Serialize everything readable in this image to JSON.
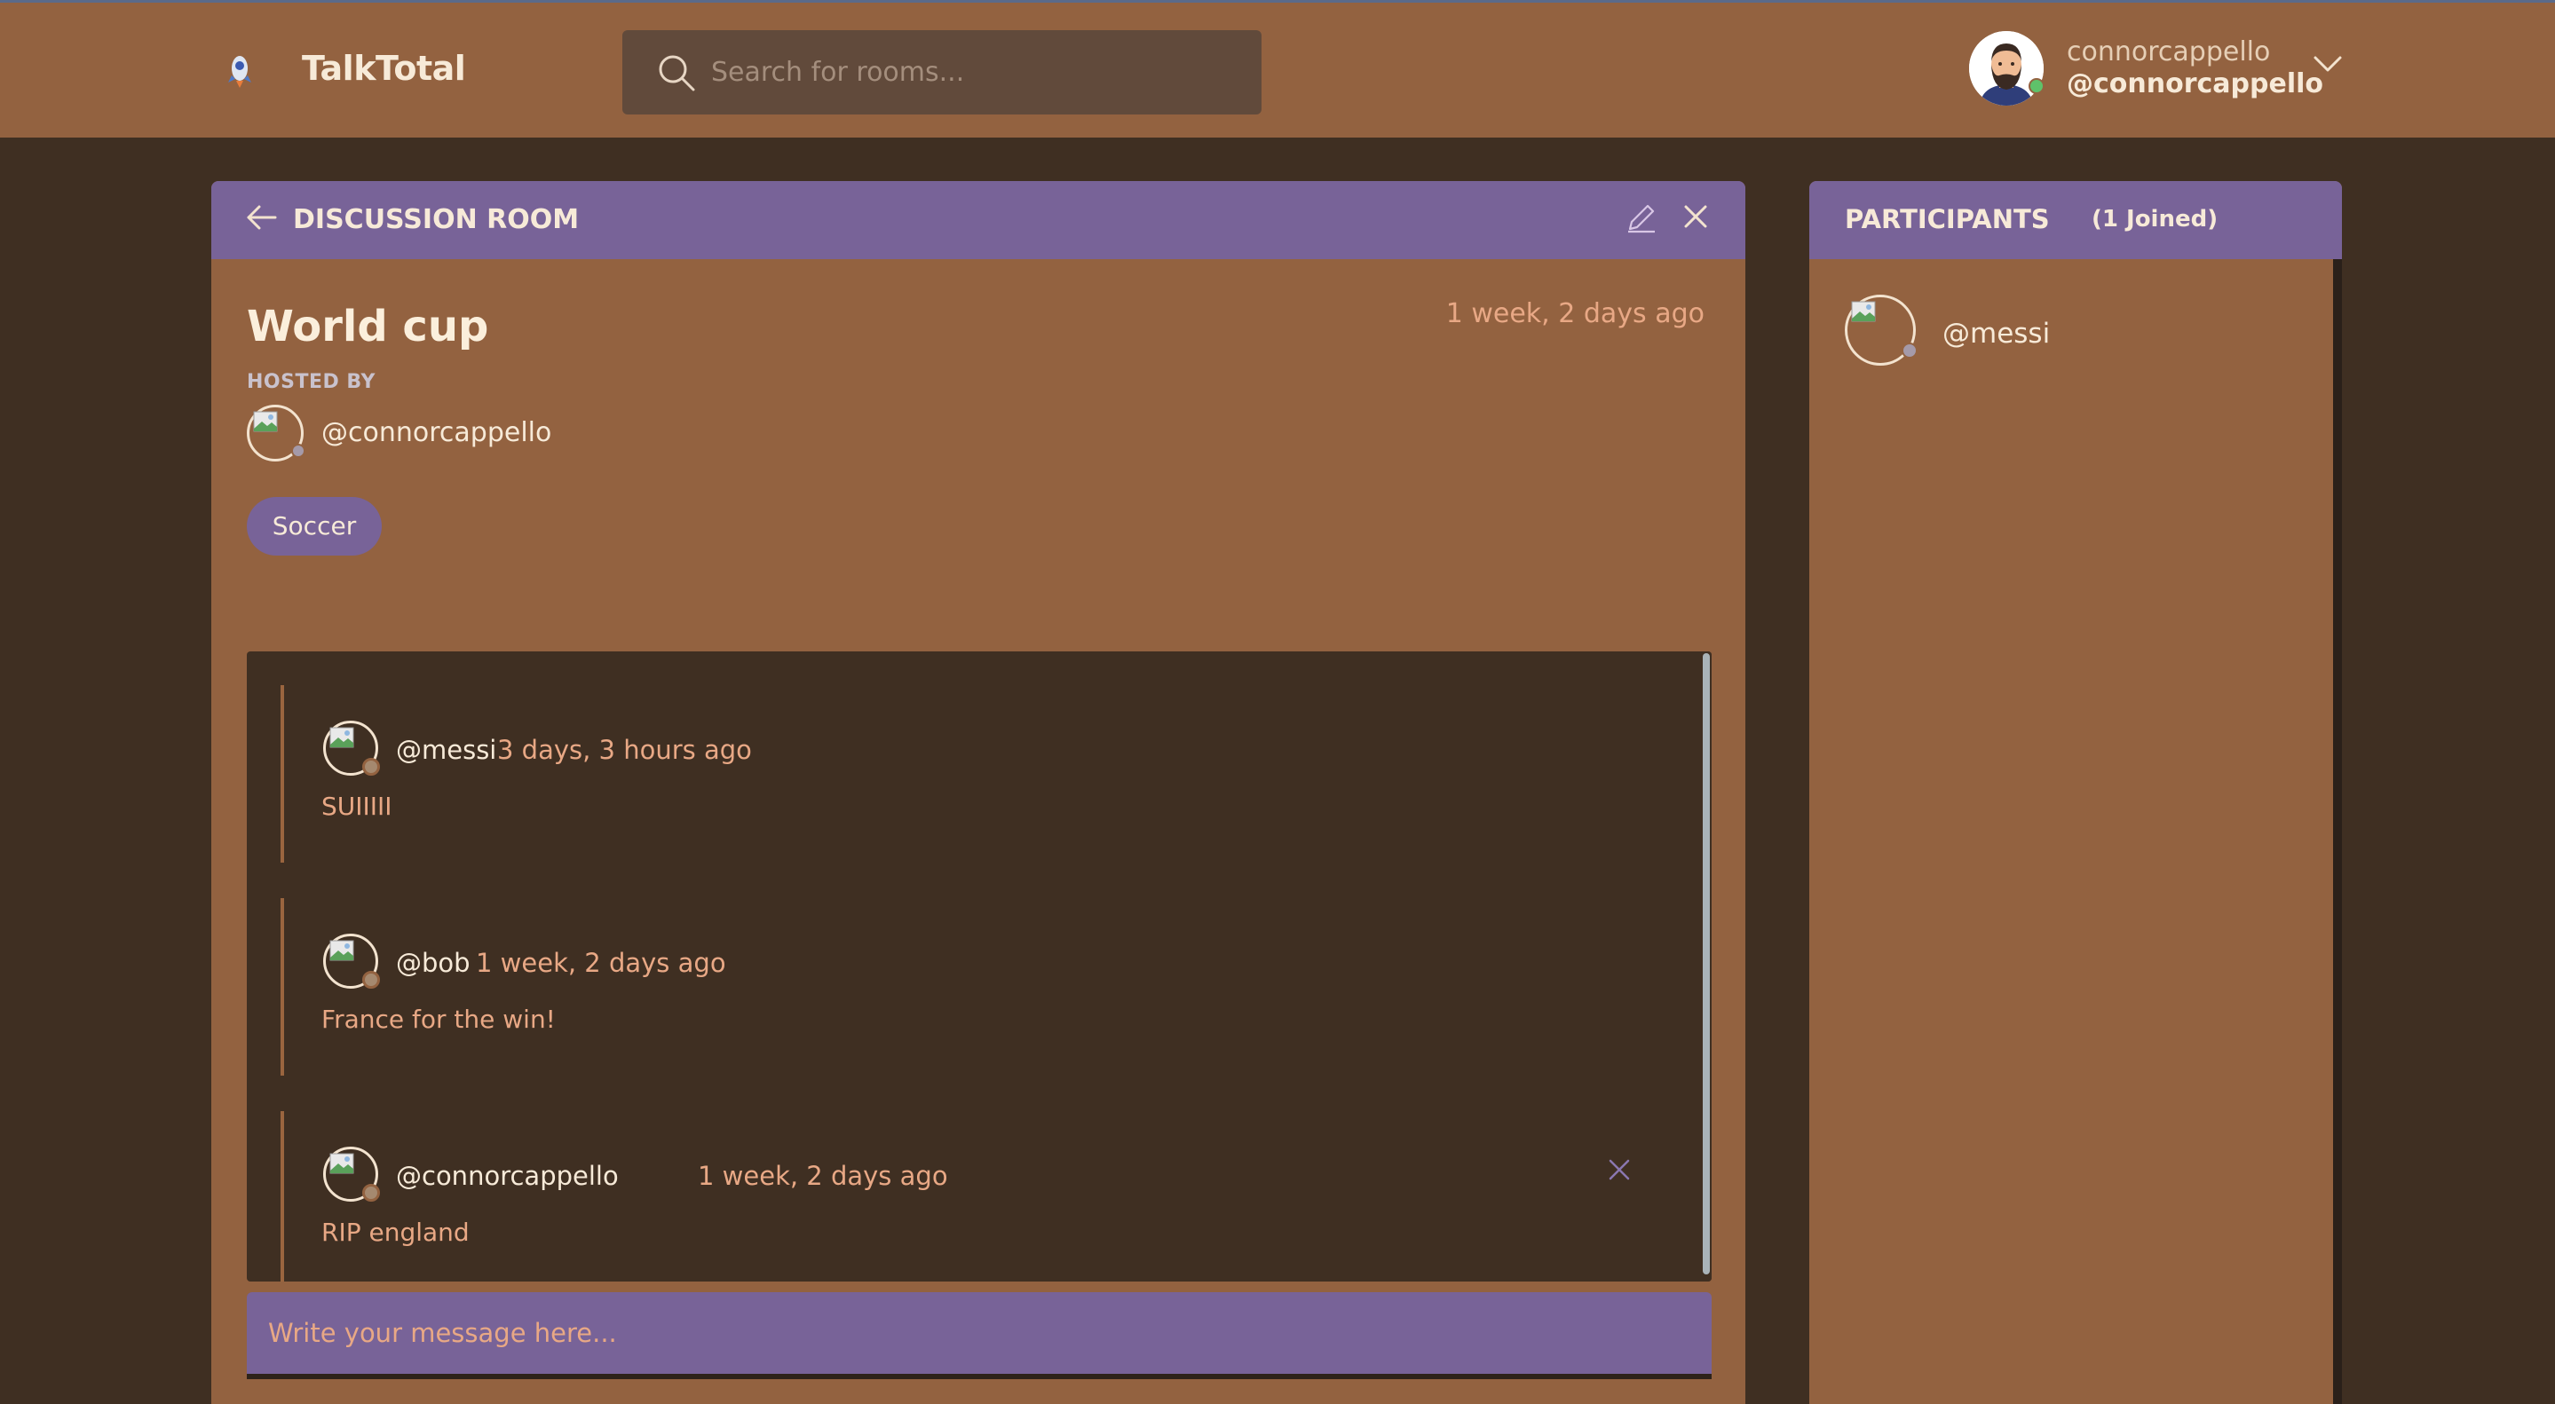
{
  "app": {
    "brand": "TalkTotal",
    "search_placeholder": "Search for rooms..."
  },
  "user": {
    "name": "connorcappello",
    "handle": "@connorcappello",
    "status": "online"
  },
  "room": {
    "header_label": "DISCUSSION ROOM",
    "title": "World cup",
    "created": "1 week, 2 days ago",
    "hosted_by_label": "HOSTED BY",
    "host": "@connorcappello",
    "topic": "Soccer",
    "composer_placeholder": "Write your message here..."
  },
  "messages": [
    {
      "user": "@messi",
      "time": "3 days, 3 hours ago",
      "body": "SUIIIII",
      "deletable": false
    },
    {
      "user": "@bob",
      "time": "1 week, 2 days ago",
      "body": "France for the win!",
      "deletable": false
    },
    {
      "user": "@connorcappello",
      "time": "1 week, 2 days ago",
      "body": "RIP england",
      "deletable": true
    }
  ],
  "participants": {
    "title": "PARTICIPANTS",
    "count_label": "(1 Joined)",
    "list": [
      {
        "handle": "@messi"
      }
    ]
  },
  "icons": {
    "logo": "rocket-logo-icon",
    "search": "search-icon",
    "dropdown": "chevron-down-icon",
    "back": "arrow-left-icon",
    "edit": "pencil-icon",
    "close": "close-icon",
    "delete": "close-icon"
  },
  "colors": {
    "background": "#3f2f22",
    "header": "#936240",
    "panel": "#936240",
    "accent": "#786398",
    "thread_bg": "#3f2f22",
    "timestamp": "#e8a885",
    "online": "#5fc26a"
  }
}
